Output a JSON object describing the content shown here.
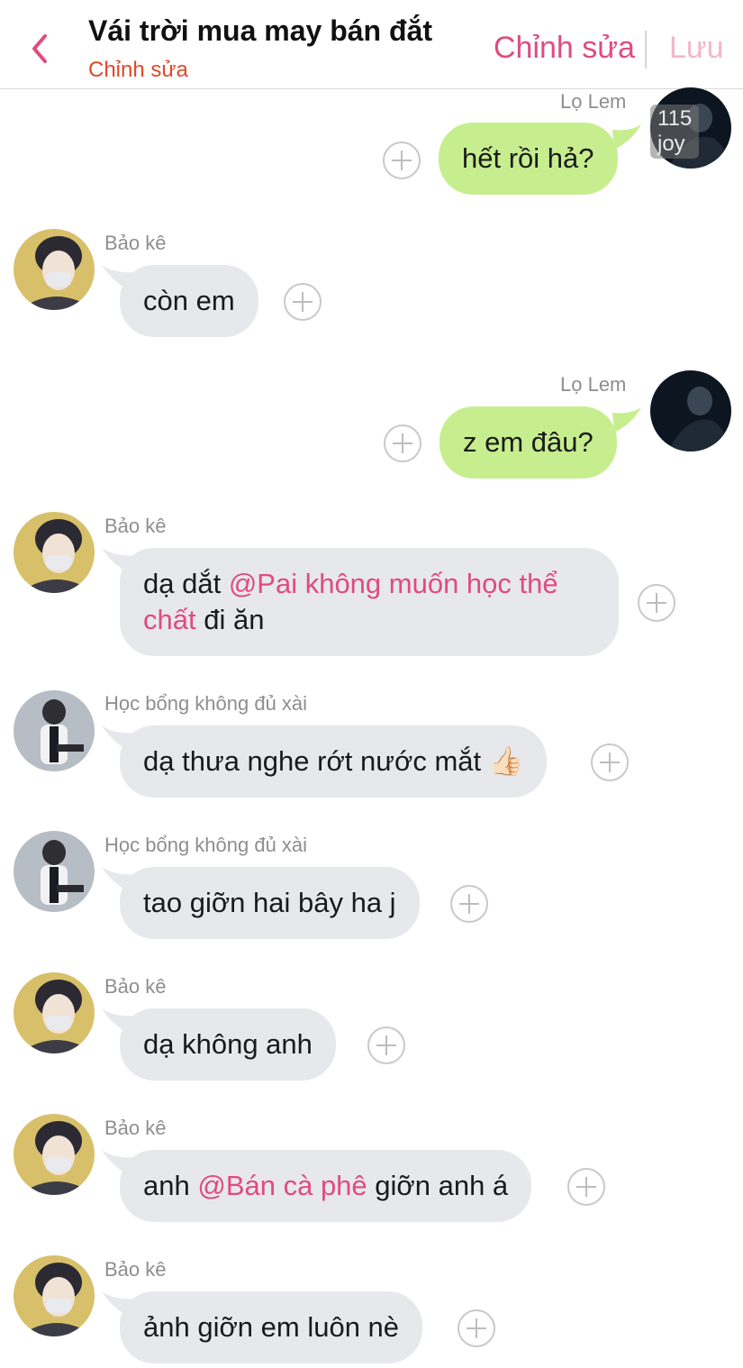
{
  "header": {
    "title": "Vái trời mua may bán đắt",
    "subtitle": "Chỉnh sửa",
    "edit_label": "Chỉnh sửa",
    "save_label": "Lưu"
  },
  "watermark": "115 joy",
  "messages": [
    {
      "sender": "Lọ Lem",
      "direction": "outgoing",
      "text": "hết rồi hả?"
    },
    {
      "sender": "Bảo kê",
      "direction": "incoming",
      "text": "còn em"
    },
    {
      "sender": "Lọ Lem",
      "direction": "outgoing",
      "text": "z em đâu?"
    },
    {
      "sender": "Bảo kê",
      "direction": "incoming",
      "text_before": "dạ dắt ",
      "mention": "@Pai không muốn học thể",
      "line2_mention": "chất",
      "text_after": " đi ăn"
    },
    {
      "sender": "Học bổng không đủ xài",
      "direction": "incoming",
      "text": "dạ thưa nghe rớt nước mắt",
      "emoji": "👍🏻"
    },
    {
      "sender": "Học bổng không đủ xài",
      "direction": "incoming",
      "text": "tao giỡn hai bây ha j"
    },
    {
      "sender": "Bảo kê",
      "direction": "incoming",
      "text": "dạ không anh"
    },
    {
      "sender": "Bảo kê",
      "direction": "incoming",
      "text_before": "anh ",
      "mention": "@Bán cà phê",
      "text_after": " giỡn anh á"
    },
    {
      "sender": "Bảo kê",
      "direction": "incoming",
      "text": "ảnh giỡn em luôn nè"
    }
  ],
  "colors": {
    "accent": "#e04c7c",
    "subtitle": "#e1472a",
    "outgoing_bubble": "#c7ee8e",
    "incoming_bubble": "#e6e8ec"
  }
}
